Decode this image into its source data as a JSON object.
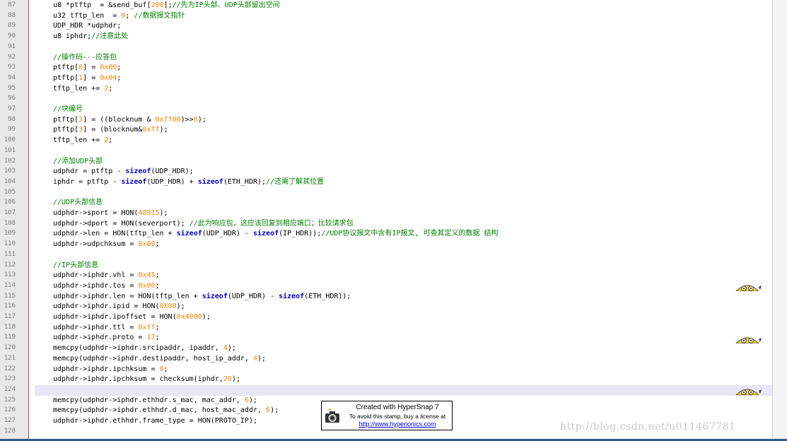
{
  "lines": [
    {
      "n": "87",
      "code": [
        [
          "",
          "u8 *ptftp  = &send_buf["
        ],
        [
          "num",
          "200"
        ],
        [
          "",
          "];"
        ],
        [
          "com",
          "//先为IP头部、UDP头部留出空间"
        ]
      ]
    },
    {
      "n": "88",
      "code": [
        [
          "",
          "u32 tftp_len  = "
        ],
        [
          "num",
          "0"
        ],
        [
          "",
          "; "
        ],
        [
          "com",
          "//数据报文指针"
        ]
      ]
    },
    {
      "n": "89",
      "code": [
        [
          "",
          "UDP_HDR *udphdr;"
        ]
      ]
    },
    {
      "n": "90",
      "code": [
        [
          "",
          "u8 iphdr;"
        ],
        [
          "com",
          "//注意此处"
        ]
      ]
    },
    {
      "n": "91",
      "code": []
    },
    {
      "n": "92",
      "code": [
        [
          "com",
          "//操作码---应答包"
        ]
      ]
    },
    {
      "n": "93",
      "code": [
        [
          "",
          "ptftp["
        ],
        [
          "num",
          "0"
        ],
        [
          "",
          "] = "
        ],
        [
          "num",
          "0x00"
        ],
        [
          "",
          ";"
        ]
      ]
    },
    {
      "n": "94",
      "code": [
        [
          "",
          "ptftp["
        ],
        [
          "num",
          "1"
        ],
        [
          "",
          "] = "
        ],
        [
          "num",
          "0x04"
        ],
        [
          "",
          ";"
        ]
      ]
    },
    {
      "n": "95",
      "code": [
        [
          "",
          "tftp_len += "
        ],
        [
          "num",
          "2"
        ],
        [
          "",
          ";"
        ]
      ]
    },
    {
      "n": "96",
      "code": []
    },
    {
      "n": "97",
      "code": [
        [
          "com",
          "//块编号"
        ]
      ]
    },
    {
      "n": "98",
      "code": [
        [
          "",
          "ptftp["
        ],
        [
          "num",
          "2"
        ],
        [
          "",
          "] = ((blocknum & "
        ],
        [
          "num",
          "0xff00"
        ],
        [
          "",
          ")>>"
        ],
        [
          "num",
          "8"
        ],
        [
          "",
          ");"
        ]
      ]
    },
    {
      "n": "99",
      "code": [
        [
          "",
          "ptftp["
        ],
        [
          "num",
          "3"
        ],
        [
          "",
          "] = (blocknum&"
        ],
        [
          "num",
          "0xff"
        ],
        [
          "",
          ");"
        ]
      ]
    },
    {
      "n": "100",
      "code": [
        [
          "",
          "tftp_len += "
        ],
        [
          "num",
          "2"
        ],
        [
          "",
          ";"
        ]
      ]
    },
    {
      "n": "101",
      "code": []
    },
    {
      "n": "102",
      "code": [
        [
          "com",
          "//添加UDP头部"
        ]
      ]
    },
    {
      "n": "103",
      "code": [
        [
          "",
          "udphdr = ptftp - "
        ],
        [
          "kw",
          "sizeof"
        ],
        [
          "",
          "(UDP_HDR);"
        ]
      ]
    },
    {
      "n": "104",
      "code": [
        [
          "",
          "iphdr = ptftp - "
        ],
        [
          "kw",
          "sizeof"
        ],
        [
          "",
          "(UDP_HDR) + "
        ],
        [
          "kw",
          "sizeof"
        ],
        [
          "",
          "(ETH_HDR);"
        ],
        [
          "com",
          "//还需了解其位置"
        ]
      ]
    },
    {
      "n": "105",
      "code": []
    },
    {
      "n": "106",
      "code": [
        [
          "com",
          "//UDP头部信息"
        ]
      ]
    },
    {
      "n": "107",
      "code": [
        [
          "",
          "udphdr->sport = HON("
        ],
        [
          "num",
          "48915"
        ],
        [
          "",
          ");"
        ]
      ]
    },
    {
      "n": "108",
      "code": [
        [
          "",
          "udphdr->dport = HON(severport); "
        ],
        [
          "com",
          "//此为响应包，这应该回复到相应端口；比较请求包"
        ]
      ]
    },
    {
      "n": "109",
      "code": [
        [
          "",
          "udphdr->len = HON(tftp_len + "
        ],
        [
          "kw",
          "sizeof"
        ],
        [
          "",
          "(UDP_HDR) - "
        ],
        [
          "kw",
          "sizeof"
        ],
        [
          "",
          "(IP_HDR));"
        ],
        [
          "com",
          "//UDP协议报文中含有IP报文, 可查其定义的数据 结构"
        ]
      ]
    },
    {
      "n": "110",
      "code": [
        [
          "",
          "udphdr->udpchksum = "
        ],
        [
          "num",
          "0x00"
        ],
        [
          "",
          ";"
        ]
      ]
    },
    {
      "n": "111",
      "code": []
    },
    {
      "n": "112",
      "code": [
        [
          "com",
          "//IP头部信息"
        ]
      ]
    },
    {
      "n": "113",
      "code": [
        [
          "",
          "udphdr->iphdr.vhl = "
        ],
        [
          "num",
          "0x45"
        ],
        [
          "",
          ";"
        ]
      ]
    },
    {
      "n": "114",
      "code": [
        [
          "",
          "udphdr->iphdr.tos = "
        ],
        [
          "num",
          "0x00"
        ],
        [
          "",
          ";"
        ]
      ]
    },
    {
      "n": "115",
      "code": [
        [
          "",
          "udphdr->iphdr.len = HON(tftp_len + "
        ],
        [
          "kw",
          "sizeof"
        ],
        [
          "",
          "(UDP_HDR) - "
        ],
        [
          "kw",
          "sizeof"
        ],
        [
          "",
          "(ETH_HDR));"
        ]
      ]
    },
    {
      "n": "116",
      "code": [
        [
          "",
          "udphdr->iphdr.ipid = HON("
        ],
        [
          "num",
          "0X00"
        ],
        [
          "",
          ");"
        ]
      ]
    },
    {
      "n": "117",
      "code": [
        [
          "",
          "udphdr->iphdr.ipoffset = HON("
        ],
        [
          "num",
          "0x4000"
        ],
        [
          "",
          ");"
        ]
      ]
    },
    {
      "n": "118",
      "code": [
        [
          "",
          "udphdr->iphdr.ttl = "
        ],
        [
          "num",
          "0xff"
        ],
        [
          "",
          ";"
        ]
      ]
    },
    {
      "n": "119",
      "code": [
        [
          "",
          "udphdr->iphdr.proto = "
        ],
        [
          "num",
          "17"
        ],
        [
          "",
          ";"
        ]
      ]
    },
    {
      "n": "120",
      "code": [
        [
          "",
          "memcpy(udphdr->iphdr.srcipaddr, ipaddr, "
        ],
        [
          "num",
          "4"
        ],
        [
          "",
          ");"
        ]
      ]
    },
    {
      "n": "121",
      "code": [
        [
          "",
          "memcpy(udphdr->iphdr.destipaddr, host_ip_addr, "
        ],
        [
          "num",
          "4"
        ],
        [
          "",
          ");"
        ]
      ]
    },
    {
      "n": "122",
      "code": [
        [
          "",
          "udphdr->iphdr.ipchksum = "
        ],
        [
          "num",
          "0"
        ],
        [
          "",
          ";"
        ]
      ]
    },
    {
      "n": "123",
      "code": [
        [
          "",
          "udphdr->iphdr.ipchksum = checksum(iphdr,"
        ],
        [
          "num",
          "20"
        ],
        [
          "",
          ");"
        ]
      ]
    },
    {
      "n": "124",
      "code": []
    },
    {
      "n": "125",
      "code": [
        [
          "",
          "memcpy(udphdr->iphdr.ethhdr.s_mac, mac_addr, "
        ],
        [
          "num",
          "6"
        ],
        [
          "",
          ");"
        ]
      ]
    },
    {
      "n": "126",
      "code": [
        [
          "",
          "memcpy(udphdr->iphdr.ethhdr.d_mac, host_mac_addr, "
        ],
        [
          "num",
          "6"
        ],
        [
          "",
          ");"
        ]
      ]
    },
    {
      "n": "127",
      "code": [
        [
          "",
          "udphdr->iphdr.ethhdr.frame_type = HON(PROTO_IP);"
        ]
      ]
    },
    {
      "n": "128",
      "code": []
    }
  ],
  "stamp": {
    "line1": "Created with HyperSnap 7",
    "line2": "To avoid this stamp, buy a license at",
    "line3": "http://www.hyperionics.com"
  },
  "watermark": "http://blog.csdn.net/u011467781",
  "colors": {
    "comment": "#008000",
    "number": "#ff8000",
    "keyword": "#0000cc",
    "gutter_line": "#cc4444"
  }
}
